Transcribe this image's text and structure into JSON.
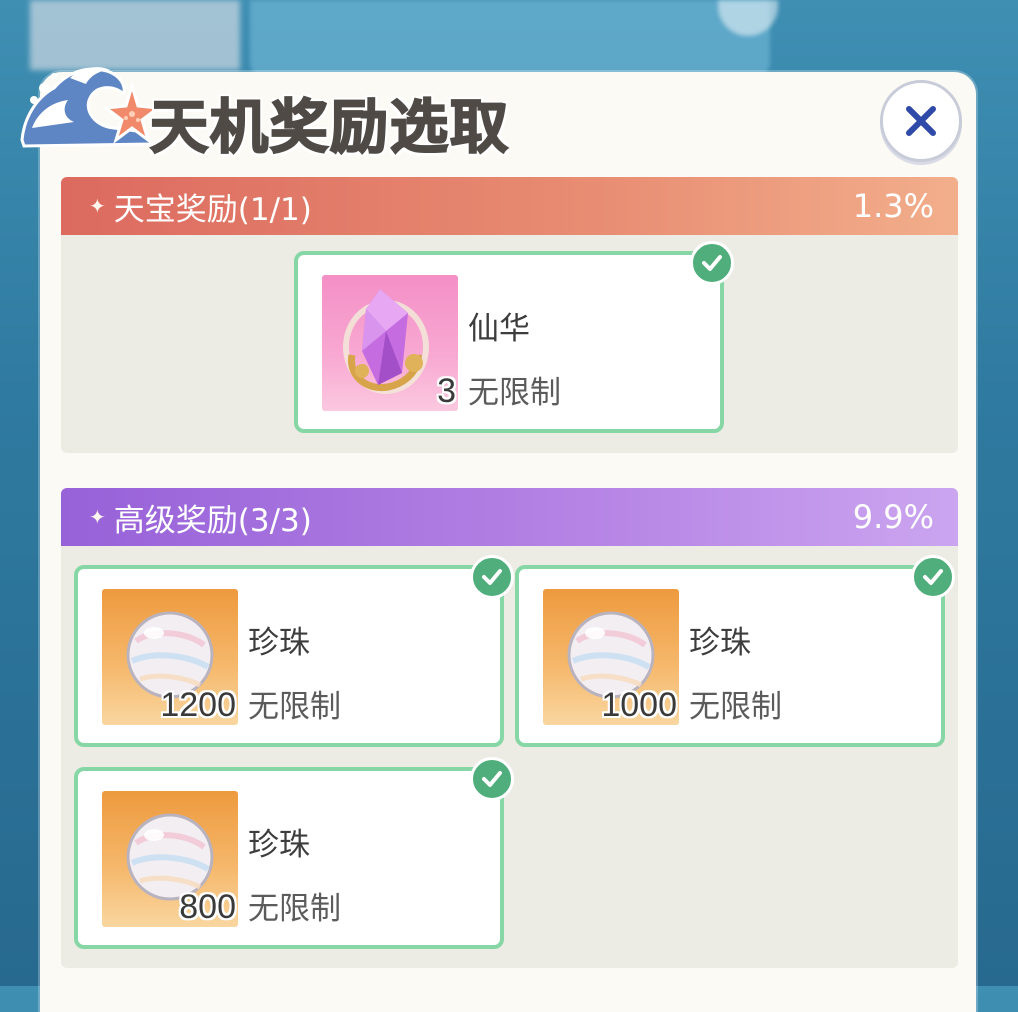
{
  "dialog": {
    "title": "天机奖励选取",
    "close_icon": "close-icon"
  },
  "sections": [
    {
      "title": "天宝奖励(1/1)",
      "percent": "1.3%",
      "color": "#dc6a5f",
      "items": [
        {
          "name": "仙华",
          "quantity": "3",
          "limit": "无限制",
          "icon": "crystal-icon",
          "selected": true
        }
      ]
    },
    {
      "title": "高级奖励(3/3)",
      "percent": "9.9%",
      "color": "#9761d8",
      "items": [
        {
          "name": "珍珠",
          "quantity": "1200",
          "limit": "无限制",
          "icon": "pearl-icon",
          "selected": true
        },
        {
          "name": "珍珠",
          "quantity": "1000",
          "limit": "无限制",
          "icon": "pearl-icon",
          "selected": true
        },
        {
          "name": "珍珠",
          "quantity": "800",
          "limit": "无限制",
          "icon": "pearl-icon",
          "selected": true
        }
      ]
    }
  ],
  "colors": {
    "card_border": "#86d7a5",
    "check_badge": "#4fae7c",
    "close_x": "#2f4aa8"
  }
}
